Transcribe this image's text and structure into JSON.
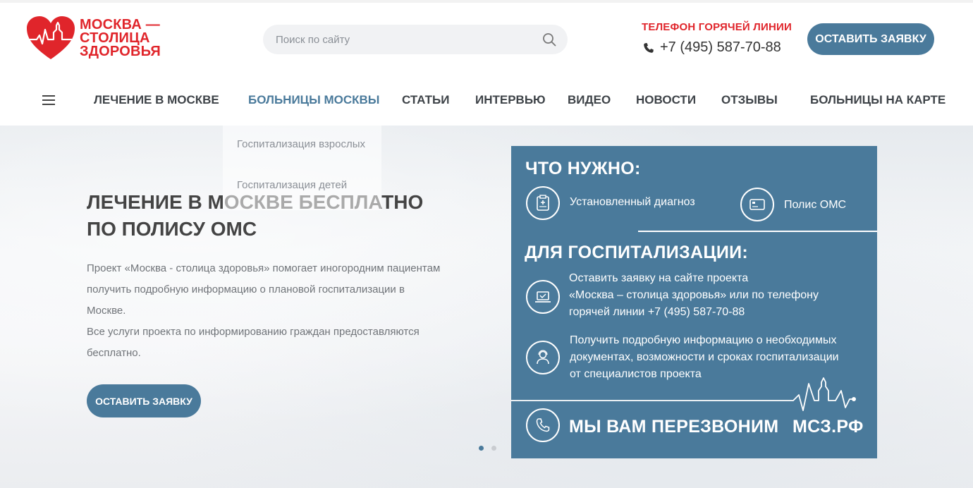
{
  "header": {
    "logo_lines": [
      "МОСКВА —",
      "СТОЛИЦА",
      "ЗДОРОВЬЯ"
    ],
    "search_placeholder": "Поиск по сайту",
    "hotline_label": "ТЕЛЕФОН ГОРЯЧЕЙ ЛИНИИ",
    "hotline_phone": "+7 (495) 587-70-88",
    "cta_label": "ОСТАВИТЬ ЗАЯВКУ"
  },
  "nav": {
    "items": [
      {
        "label": "ЛЕЧЕНИЕ В МОСКВЕ"
      },
      {
        "label": "БОЛЬНИЦЫ МОСКВЫ"
      },
      {
        "label": "СТАТЬИ"
      },
      {
        "label": "ИНТЕРВЬЮ"
      },
      {
        "label": "ВИДЕО"
      },
      {
        "label": "НОВОСТИ"
      },
      {
        "label": "ОТЗЫВЫ"
      },
      {
        "label": "БОЛЬНИЦЫ НА КАРТЕ"
      }
    ],
    "active_index": 1,
    "dropdown": [
      "Госпитализация взрослых",
      "Госпитализация детей"
    ]
  },
  "hero": {
    "title": "ЛЕЧЕНИЕ В МОСКВЕ БЕСПЛАТНО ПО ПОЛИСУ ОМС",
    "text_lines": [
      "Проект «Москва - столица здоровья» помогает иногородним пациентам",
      "получить подробную информацию о плановой госпитализации в",
      "Москве.",
      "Все услуги проекта по информированию граждан предоставляются",
      "бесплатно."
    ],
    "cta_label": "ОСТАВИТЬ ЗАЯВКУ",
    "slides_total": 2,
    "slide_active": 1
  },
  "panel": {
    "need_title": "ЧТО НУЖНО:",
    "need_items": [
      "Установленный диагноз",
      "Полис ОМС"
    ],
    "hosp_title": "ДЛЯ ГОСПИТАЛИЗАЦИИ:",
    "step1_lines": [
      "Оставить заявку на сайте проекта",
      "«Москва – столица здоровья»  или по телефону",
      "горячей линии +7 (495) 587-70-88"
    ],
    "step2_lines": [
      "Получить подробную информацию о необходимых",
      "документах, возможности и сроках госпитализации",
      "от специалистов проекта"
    ],
    "callback": "МЫ ВАМ ПЕРЕЗВОНИМ",
    "site": "МСЗ.РФ"
  },
  "colors": {
    "brand_red": "#e0252b",
    "accent_blue": "#4a7a9b"
  }
}
